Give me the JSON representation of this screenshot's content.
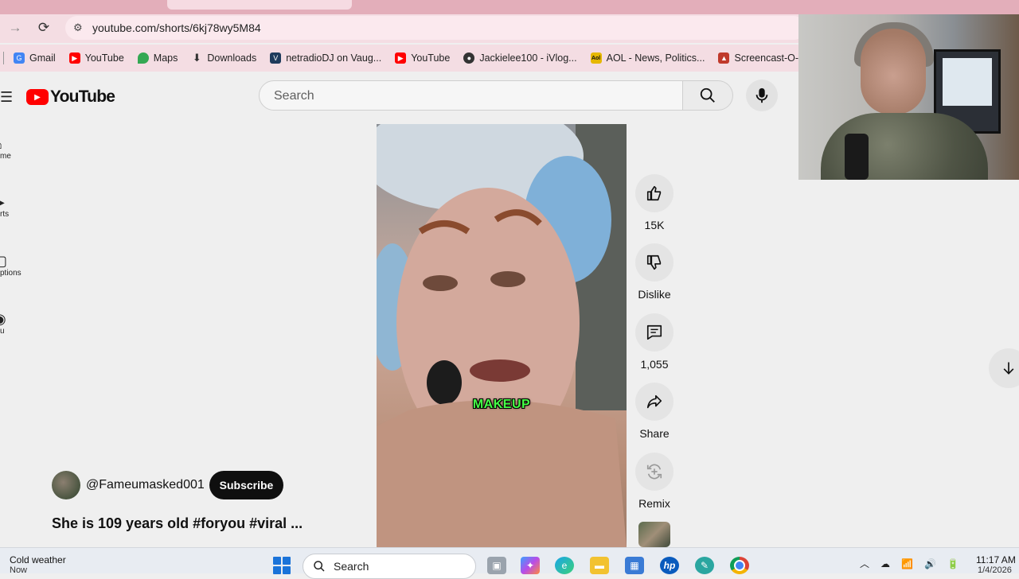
{
  "browser": {
    "url": "youtube.com/shorts/6kj78wy5M84",
    "bookmarks": [
      {
        "label": "Gmail",
        "icon": "google-icon",
        "color": "#4285f4"
      },
      {
        "label": "YouTube",
        "icon": "youtube-icon",
        "color": "#ff0000"
      },
      {
        "label": "Maps",
        "icon": "maps-icon",
        "color": "#34a853"
      },
      {
        "label": "Downloads",
        "icon": "download-icon",
        "color": "#333333"
      },
      {
        "label": "netradioDJ on Vaug...",
        "icon": "netradio-icon",
        "color": "#1f3b5c"
      },
      {
        "label": "YouTube",
        "icon": "youtube-icon",
        "color": "#ff0000"
      },
      {
        "label": "Jackielee100 - iVlog...",
        "icon": "vlog-icon",
        "color": "#333333"
      },
      {
        "label": "AOL - News, Politics...",
        "icon": "aol-icon",
        "color": "#e6b800"
      },
      {
        "label": "Screencast-O-Matic",
        "icon": "screencast-icon",
        "color": "#c0392b"
      }
    ]
  },
  "youtube": {
    "logo_text": "YouTube",
    "search_placeholder": "Search",
    "sidebar": [
      "me",
      "rts",
      "ptions",
      "u"
    ],
    "short": {
      "caption": "MAKEUP",
      "likes": "15K",
      "dislike_label": "Dislike",
      "comments": "1,055",
      "share_label": "Share",
      "remix_label": "Remix",
      "channel_handle": "@Fameumasked001",
      "subscribe_label": "Subscribe",
      "title": "She is 109 years old #foryou #viral ..."
    }
  },
  "taskbar": {
    "weather_title": "Cold weather",
    "weather_sub": "Now",
    "search_label": "Search",
    "time": "11:17 AM",
    "date": "1/4/2026"
  }
}
